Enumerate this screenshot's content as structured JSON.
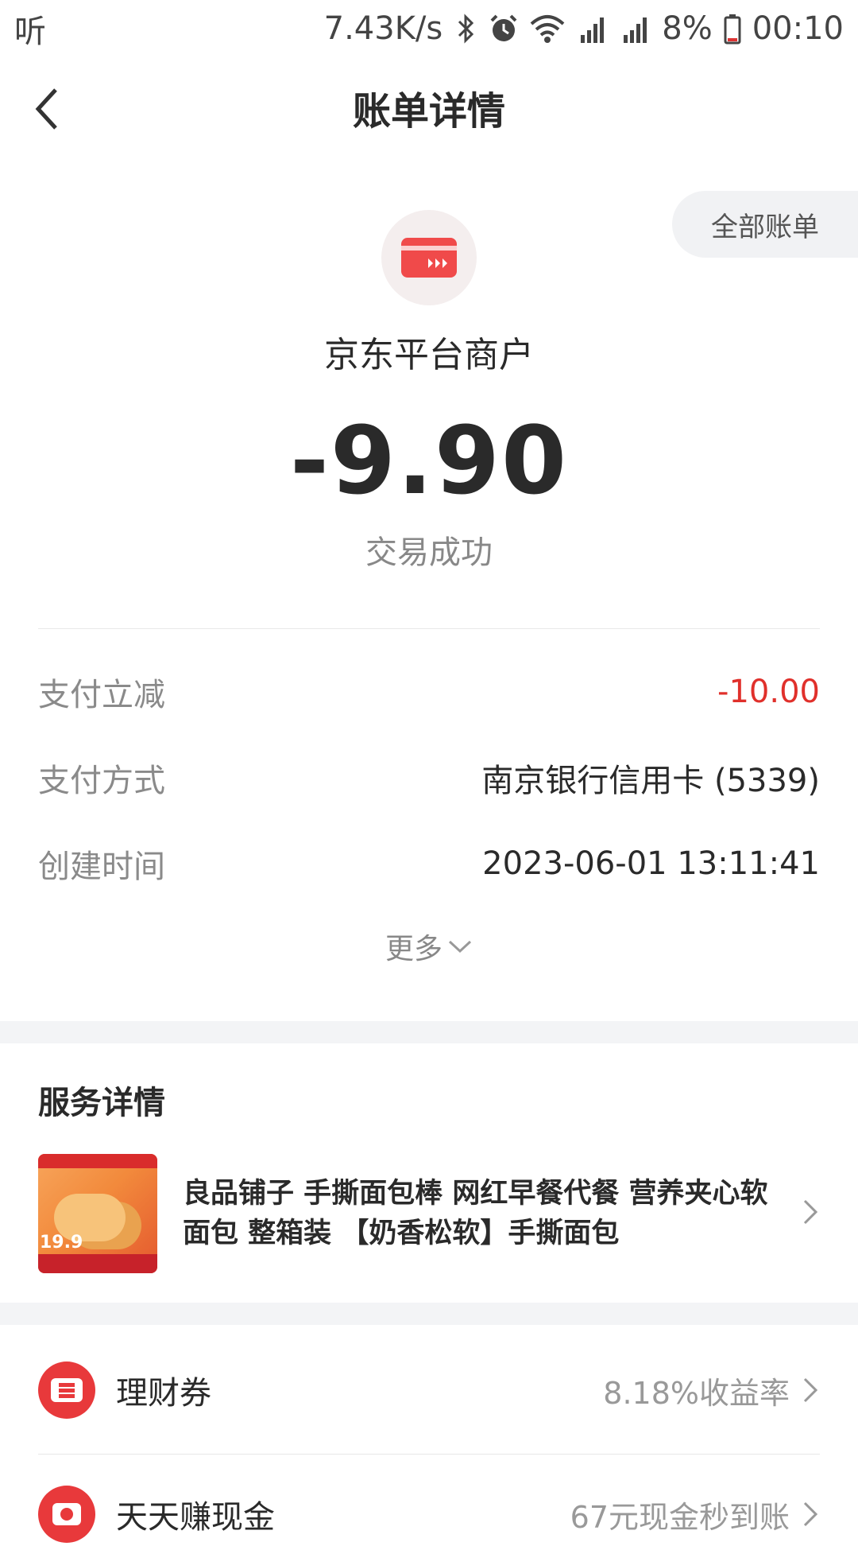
{
  "status_bar": {
    "left_app": "听",
    "net_speed": "7.43K/s",
    "battery": "8%",
    "time": "00:10"
  },
  "header": {
    "title": "账单详情",
    "all_bills": "全部账单"
  },
  "summary": {
    "merchant": "京东平台商户",
    "amount": "-9.90",
    "status": "交易成功"
  },
  "details": [
    {
      "label": "支付立减",
      "value": "-10.00"
    },
    {
      "label": "支付方式",
      "value": "南京银行信用卡 (5339)"
    },
    {
      "label": "创建时间",
      "value": "2023-06-01 13:11:41"
    }
  ],
  "more_label": "更多",
  "service": {
    "title": "服务详情",
    "product_text": "良品铺子 手撕面包棒  网红早餐代餐 营养夹心软面包 整箱装 【奶香松软】手撕面包",
    "thumb_price": "19.9"
  },
  "promos": [
    {
      "label": "理财券",
      "value": "8.18%收益率"
    },
    {
      "label": "天天赚现金",
      "value": "67元现金秒到账"
    }
  ],
  "colors": {
    "accent_red": "#e0302b",
    "muted_gray": "#8a8a8a",
    "section_gap": "#f3f4f6"
  }
}
